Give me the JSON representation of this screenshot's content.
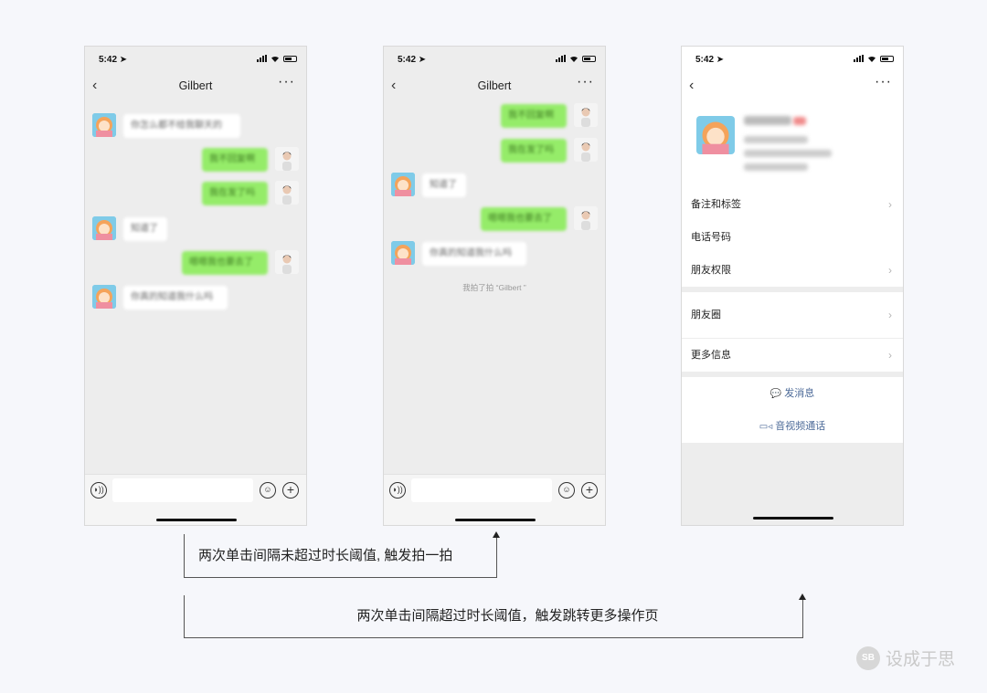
{
  "status": {
    "time": "5:42 ➤"
  },
  "phone1": {
    "title": "Gilbert",
    "back": "‹",
    "more": "···",
    "messages": [
      "你怎么都不给我聊天的",
      "我不回复啊",
      "我在发了吗",
      "知道了",
      "嗯嗯我也要去了",
      "你真的知道我什么吗"
    ]
  },
  "phone2": {
    "title": "Gilbert",
    "back": "‹",
    "more": "···",
    "messages": [
      "我不回复啊",
      "我在发了吗",
      "知道了",
      "嗯嗯我也要去了",
      "你真的知道我什么吗"
    ],
    "pat_notice": "我拍了拍 “Gilbert ”"
  },
  "phone3": {
    "back": "‹",
    "more": "···",
    "rows": [
      {
        "label": "备注和标签",
        "chev": "›"
      },
      {
        "label": "电话号码"
      },
      {
        "label": "朋友权限",
        "chev": "›"
      },
      {
        "label": "朋友圈",
        "chev": "›"
      },
      {
        "label": "更多信息",
        "chev": "›"
      }
    ],
    "actions": [
      {
        "icon": "💬",
        "label": "发消息"
      },
      {
        "icon": "▭◃",
        "label": "音视频通话"
      }
    ]
  },
  "input_bar": {
    "voice": "◗))",
    "emoji": "☺",
    "plus": "+"
  },
  "annotations": {
    "note1": "两次单击间隔未超过时长阈值, 触发拍一拍",
    "note2": "两次单击间隔超过时长阈值，触发跳转更多操作页"
  },
  "brand": {
    "name": "设成于思",
    "icon_text": "SB"
  }
}
